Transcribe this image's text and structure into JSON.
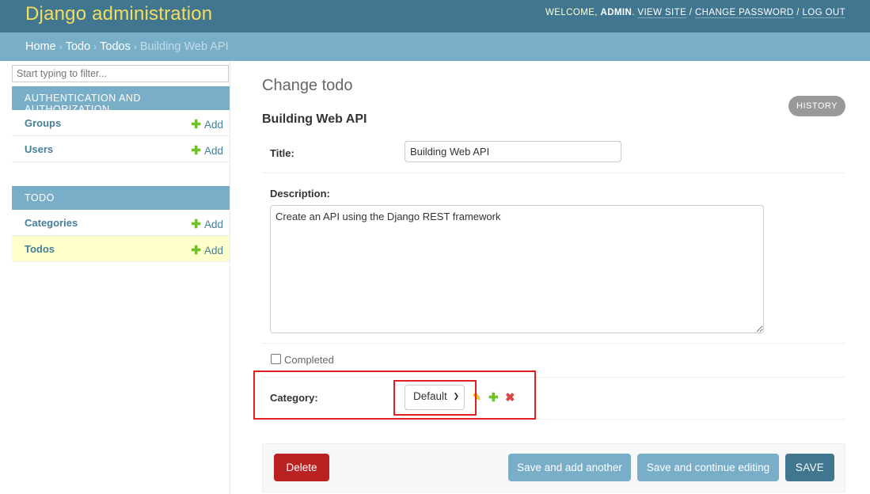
{
  "header": {
    "branding": "Django administration",
    "welcome": "Welcome,",
    "username": "admin",
    "view_site": "View site",
    "change_password": "Change password",
    "log_out": "Log out",
    "separator": "/"
  },
  "breadcrumbs": [
    "Home",
    "Todo",
    "Todos",
    "Building Web API"
  ],
  "sidebar": {
    "filter_placeholder": "Start typing to filter...",
    "modules": [
      {
        "caption": "Authentication and Authorization",
        "items": [
          {
            "label": "Groups",
            "add": "Add"
          },
          {
            "label": "Users",
            "add": "Add"
          }
        ]
      },
      {
        "caption": "Todo",
        "items": [
          {
            "label": "Categories",
            "add": "Add"
          },
          {
            "label": "Todos",
            "add": "Add",
            "current": true
          }
        ]
      }
    ]
  },
  "content": {
    "title": "Change todo",
    "history": "History",
    "object_title": "Building Web API",
    "fields": {
      "title_label": "Title:",
      "title_value": "Building Web API",
      "description_label": "Description:",
      "description_value": "Create an API using the Django REST framework",
      "completed_label": "Completed",
      "completed_checked": false,
      "category_label": "Category:",
      "category_value": "Default"
    },
    "buttons": {
      "delete": "Delete",
      "save_add_another": "Save and add another",
      "save_continue": "Save and continue editing",
      "save": "Save"
    }
  },
  "colors": {
    "header_bg": "#417690",
    "branding": "#f5dd5d",
    "breadcrumbs_bg": "#79aec8",
    "module_caption_bg": "#79aec8",
    "current_row_bg": "#ffffcc",
    "delete_button": "#ba2121",
    "highlight_box": "#e02020"
  },
  "icons": {
    "add": "plus-icon",
    "change_related": "pencil-icon",
    "add_related": "plus-icon",
    "delete_related": "x-icon"
  }
}
